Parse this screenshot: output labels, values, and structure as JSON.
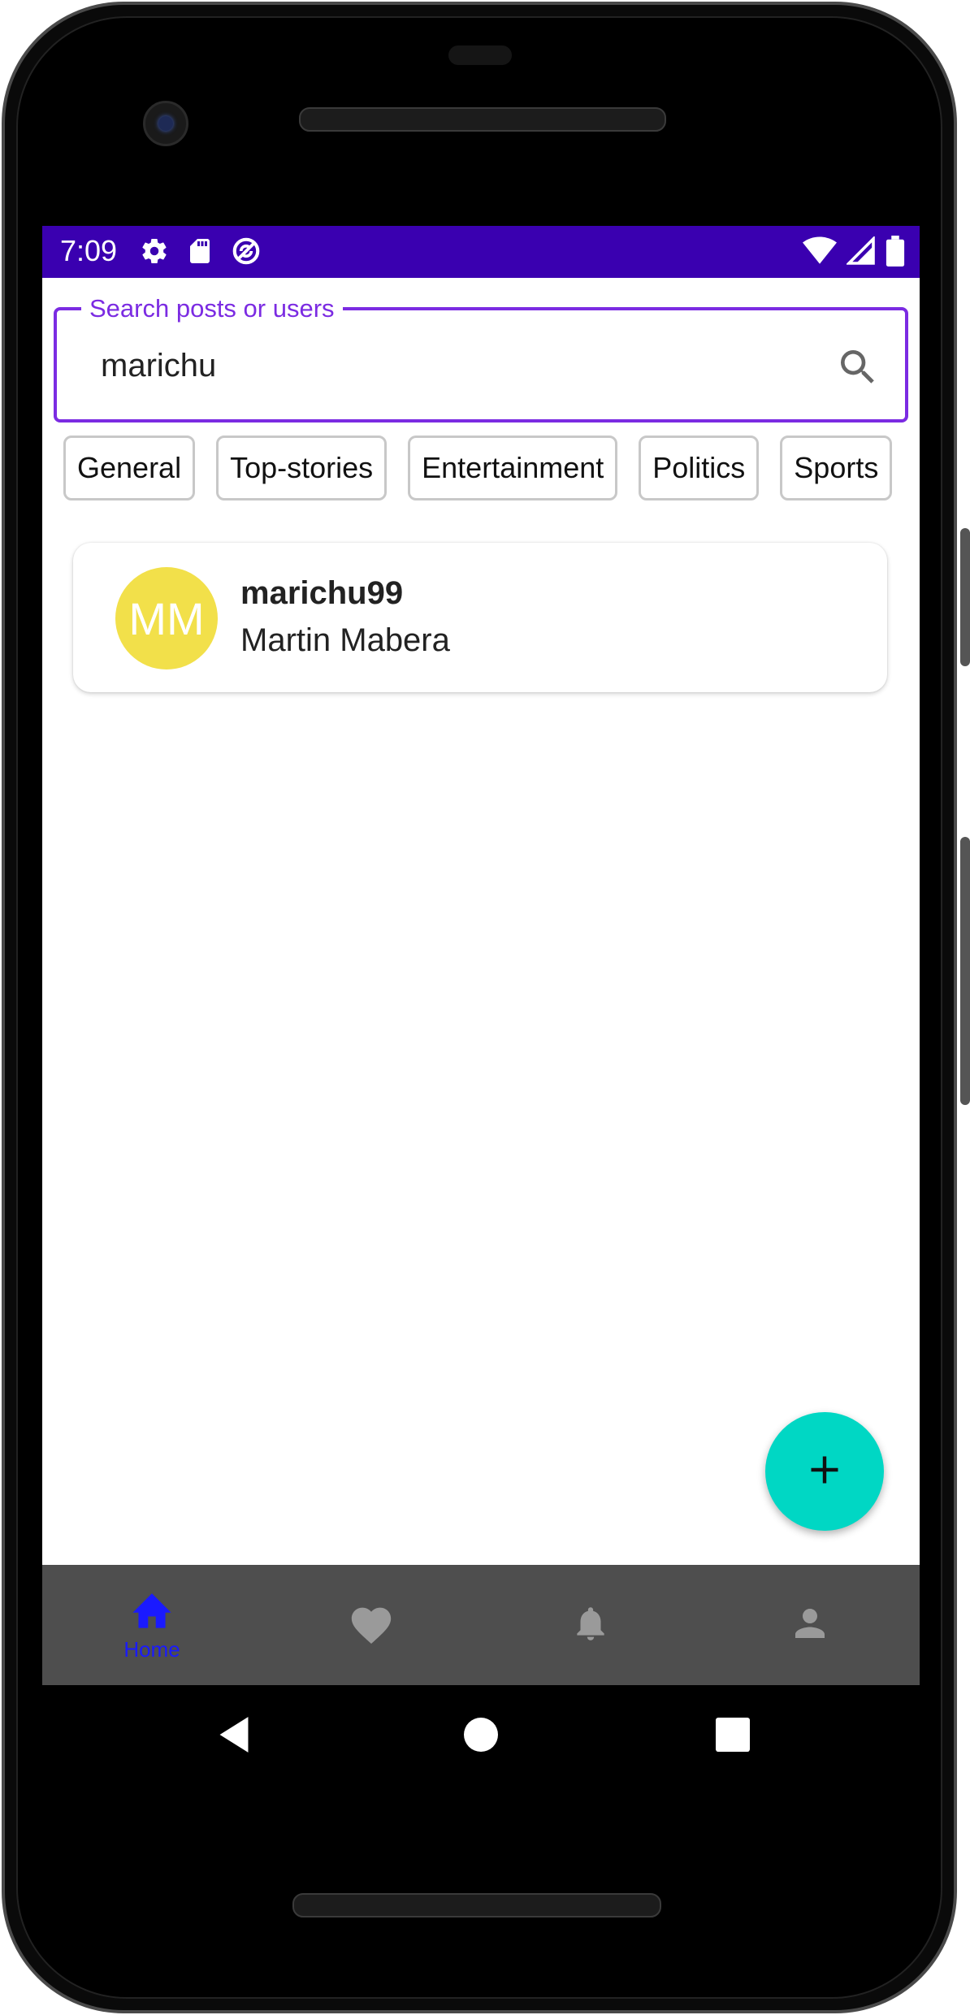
{
  "status_bar": {
    "time": "7:09",
    "left_icons": [
      "gear-icon",
      "sd-card-icon",
      "sync-icon"
    ],
    "right_icons": [
      "wifi-icon",
      "signal-icon",
      "battery-icon"
    ],
    "color": "#3a00b0"
  },
  "search": {
    "label": "Search posts or users",
    "value": "marichu",
    "accent_color": "#7b2be2"
  },
  "categories": [
    "General",
    "Top-stories",
    "Entertainment",
    "Politics",
    "Sports"
  ],
  "results": [
    {
      "initials": "MM",
      "username": "marichu99",
      "full_name": "Martin Mabera",
      "avatar_color": "#f2e04a"
    }
  ],
  "fab": {
    "icon": "plus-icon",
    "color": "#00d7c4"
  },
  "bottom_nav": {
    "items": [
      {
        "icon": "home-icon",
        "label": "Home",
        "active": true
      },
      {
        "icon": "heart-icon",
        "label": "",
        "active": false
      },
      {
        "icon": "bell-icon",
        "label": "",
        "active": false
      },
      {
        "icon": "person-icon",
        "label": "",
        "active": false
      }
    ],
    "active_color": "#1a1aff",
    "inactive_color": "#9a9a9a"
  },
  "system_nav": [
    "back-icon",
    "home-circle-icon",
    "recents-icon"
  ]
}
